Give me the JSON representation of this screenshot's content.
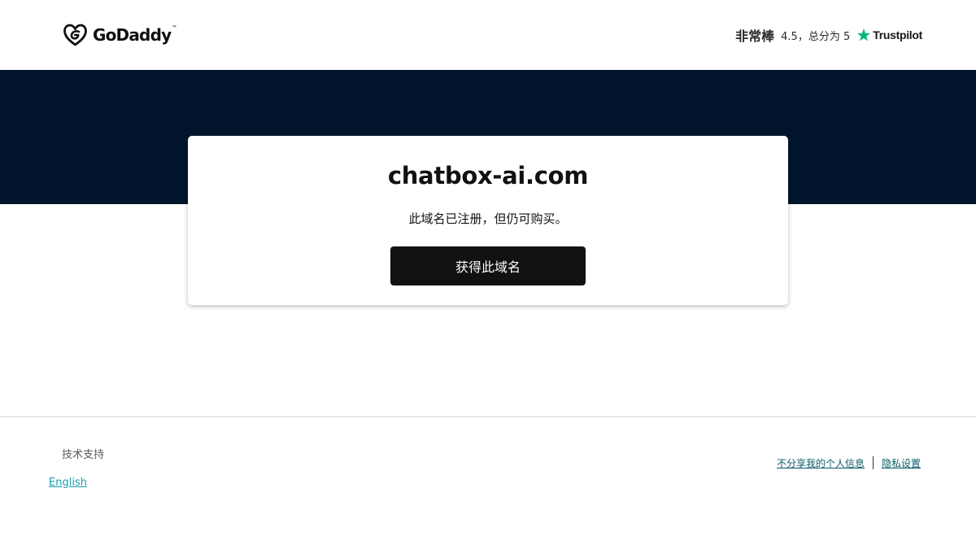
{
  "header": {
    "logo": {
      "text": "GoDaddy",
      "icon": "godaddy-heart-logo-icon"
    },
    "rating": {
      "word": "非常棒",
      "score": "4.5，总分为 5",
      "brand": "Trustpilot",
      "star_icon": "trustpilot-star-icon",
      "star_color": "#00b67a"
    }
  },
  "hero": {
    "band_color": "#00152b",
    "domain": "chatbox-ai.com",
    "status": "此域名已注册，但仍可购买。",
    "cta_label": "获得此域名"
  },
  "footer": {
    "support": "技术支持",
    "language": "English",
    "legal": {
      "do_not_share": "不分享我的个人信息",
      "privacy_settings": "隐私设置"
    }
  }
}
